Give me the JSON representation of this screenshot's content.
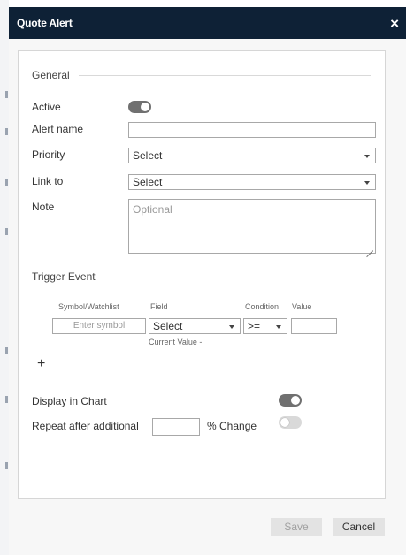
{
  "dialog": {
    "title": "Quote Alert",
    "close_glyph": "×",
    "close_icon": "close-icon"
  },
  "general": {
    "heading": "General",
    "active_label": "Active",
    "active_on": true,
    "alert_name_label": "Alert name",
    "alert_name_value": "",
    "priority_label": "Priority",
    "priority_value": "Select",
    "link_to_label": "Link to",
    "link_to_value": "Select",
    "note_label": "Note",
    "note_placeholder": "Optional"
  },
  "trigger": {
    "heading": "Trigger Event",
    "col_symbol": "Symbol/Watchlist",
    "col_field": "Field",
    "col_condition": "Condition",
    "col_value": "Value",
    "symbol_placeholder": "Enter symbol",
    "field_value": "Select",
    "condition_value": ">=",
    "value_value": "",
    "current_value_label": "Current Value -",
    "add_glyph": "+"
  },
  "options": {
    "display_in_chart_label": "Display in Chart",
    "display_in_chart_on": true,
    "repeat_label": "Repeat after additional",
    "repeat_value": "",
    "pct_change_label": "% Change",
    "repeat_on": false
  },
  "buttons": {
    "save": "Save",
    "cancel": "Cancel"
  },
  "colors": {
    "titlebar": "#0e2136",
    "toggle_on": "#707070",
    "toggle_off": "#d9d9d9"
  }
}
